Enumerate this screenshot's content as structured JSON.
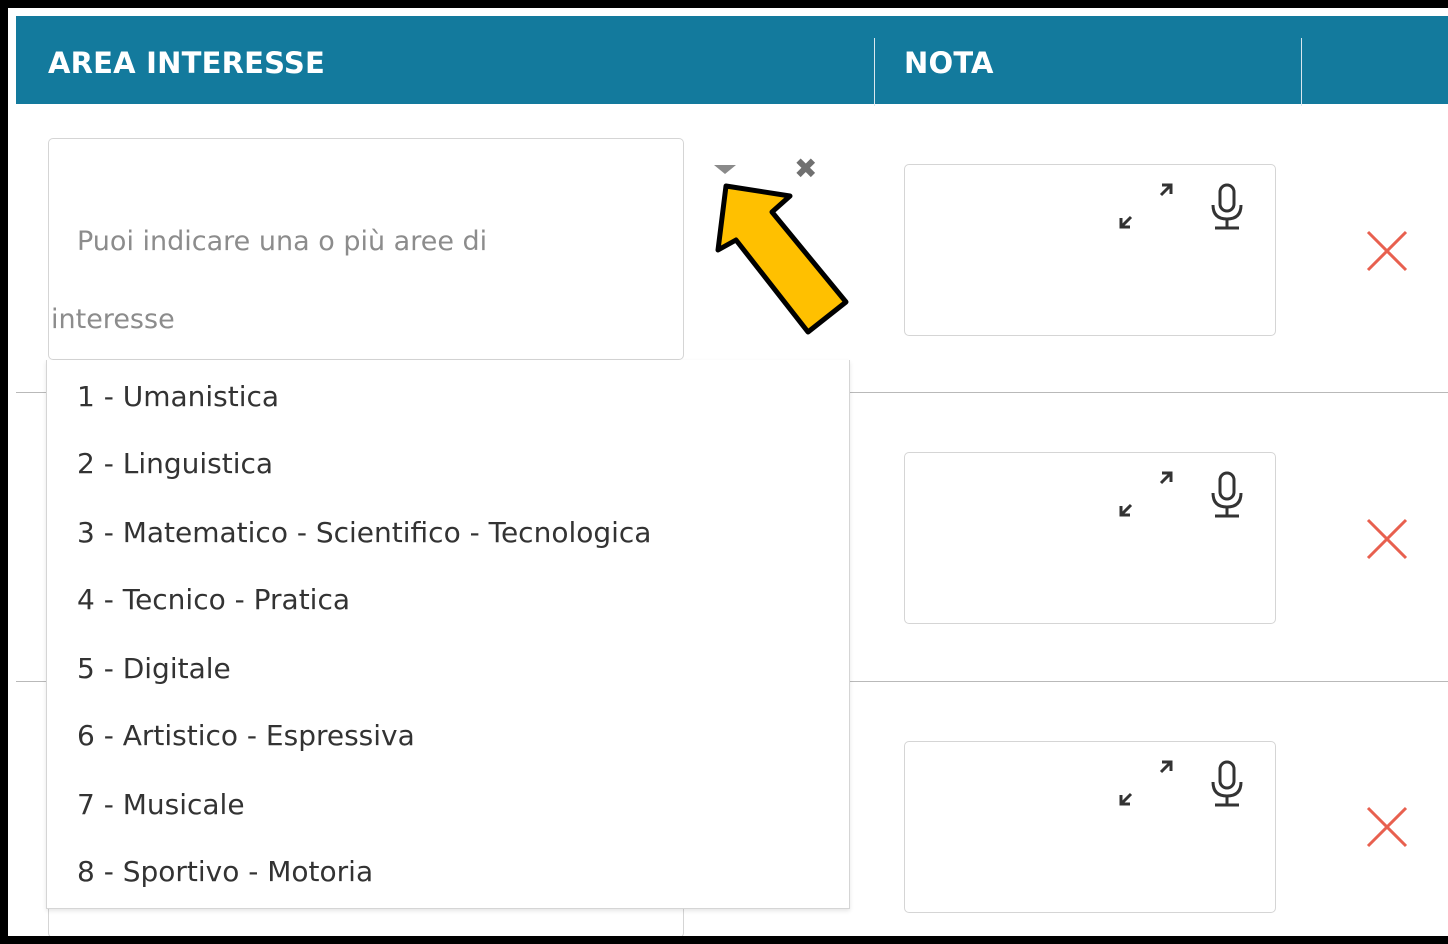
{
  "header": {
    "col_area": "AREA INTERESSE",
    "col_nota": "NOTA"
  },
  "select": {
    "placeholder_line1": "Puoi indicare una o più aree di",
    "placeholder_line2": "interesse",
    "caret_icon": "caret-down-icon",
    "clear_icon": "clear-x-icon"
  },
  "dropdown": {
    "options": [
      "1 - Umanistica",
      "2 - Linguistica",
      "3 - Matematico - Scientifico - Tecnologica",
      "4 - Tecnico - Pratica",
      "5 - Digitale",
      "6 - Artistico - Espressiva",
      "7 - Musicale",
      "8 - Sportivo - Motoria"
    ]
  },
  "rows": [
    {
      "note_value": "",
      "expand_icon": "expand-icon",
      "mic_icon": "microphone-icon",
      "delete_icon": "delete-x-icon"
    },
    {
      "note_value": "",
      "expand_icon": "expand-icon",
      "mic_icon": "microphone-icon",
      "delete_icon": "delete-x-icon"
    },
    {
      "note_value": "",
      "expand_icon": "expand-icon",
      "mic_icon": "microphone-icon",
      "delete_icon": "delete-x-icon"
    }
  ],
  "colors": {
    "header_bg": "#137a9d",
    "delete_red": "#e8604f",
    "annotation_arrow": "#ffc000"
  },
  "annotation": {
    "arrow_icon": "annotation-arrow-icon"
  }
}
